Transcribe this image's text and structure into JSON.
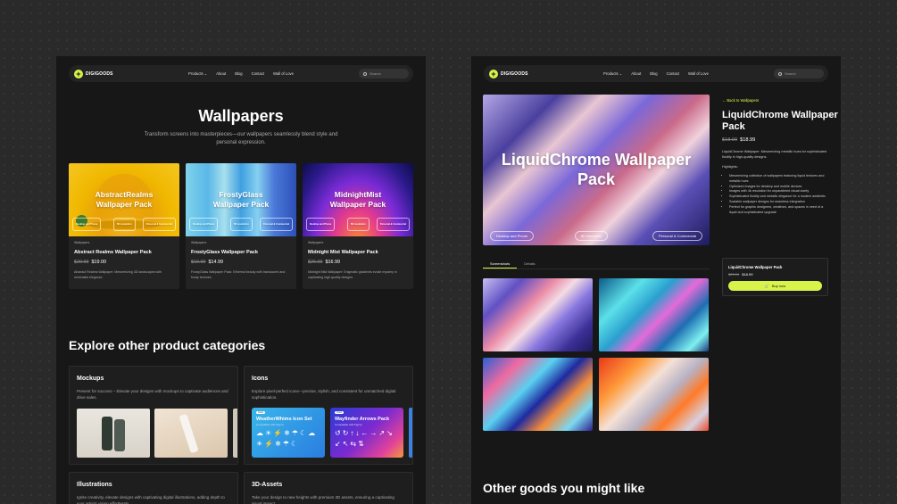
{
  "left": {
    "nav": {
      "brand": "DIGIGOODS",
      "links": [
        "Products",
        "About",
        "Blog",
        "Contact",
        "Wall of Love"
      ],
      "products_caret": "⌄",
      "search_placeholder": "Search"
    },
    "title": "Wallpapers",
    "subtitle": "Transform screens into masterpieces—our wallpapers seamlessly blend style and personal expression.",
    "cards": [
      {
        "thumb_title": "AbstractRealms Wallpaper Pack",
        "category": "Wallpapers",
        "title": "Abstract Realms Wallpaper Pack",
        "old_price": "$29.99",
        "price": "$19.00",
        "desc": "Abstract Realms Wallpaper: Mesmerizing 3D landscapes with minimalist elegance.",
        "pills": [
          "Desktop and Phone",
          "5K resolution",
          "Personal & Commercial"
        ]
      },
      {
        "thumb_title": "FrostyGlass Wallpaper Pack",
        "category": "Wallpapers",
        "title": "FrostyGlass Wallpaper Pack",
        "old_price": "$19.99",
        "price": "$14.99",
        "desc": "FrostyGlass Wallpaper Pack: Ethereal beauty with translucent and frosty textures.",
        "pills": [
          "Desktop and Phone",
          "5K resolution",
          "Personal & Commercial"
        ]
      },
      {
        "thumb_title": "MidnightMist Wallpaper Pack",
        "category": "Wallpapers",
        "title": "Midnight Mist Wallpaper Pack",
        "old_price": "$26.99",
        "price": "$16.99",
        "desc": "Midnight Mist Wallpaper: Enigmatic gradients evoke mystery in captivating high-quality designs.",
        "pills": [
          "Desktop and Phone",
          "5K resolution",
          "Personal & Commercial"
        ]
      }
    ],
    "explore_title": "Explore other product categories",
    "categories": [
      {
        "title": "Mockups",
        "desc": "Present for success – Elevate your designs with mockups to captivate audiences and drive sales."
      },
      {
        "title": "Icons",
        "desc": "Explore pixel-perfect icons—precise, stylish, and consistent for unmatched digital sophistication.",
        "packs": [
          {
            "tag": "Icons",
            "title": "WeatherWhims Icon Set",
            "sub": "Compatible with Figma",
            "glyphs": "☁☀⚡❄☂☾☁☀⚡❄☂☾"
          },
          {
            "tag": "Icons",
            "title": "Wayfinder Arrows Pack",
            "sub": "Compatible with Figma",
            "glyphs": "↺↻↑↓←→↗↘↙↖⇆⇅"
          }
        ]
      },
      {
        "title": "Illustrations",
        "desc": "Ignite creativity, elevate designs with captivating digital illustrations, adding depth to your artistic vision effortlessly."
      },
      {
        "title": "3D-Assets",
        "desc": "Take your design to new heights with premium 3D assets, ensuring a captivating visual impact."
      }
    ]
  },
  "right": {
    "nav": {
      "brand": "DIGIGOODS",
      "links": [
        "Products",
        "About",
        "Blog",
        "Contact",
        "Wall of Love"
      ],
      "products_caret": "⌄",
      "search_placeholder": "Search"
    },
    "hero": {
      "title": "LiquidChrome Wallpaper Pack",
      "pills": [
        "Desktop and Phone",
        "5K resolution",
        "Personal & Commercial"
      ]
    },
    "back": "← Back to Wallpapers",
    "title": "LiquidChrome Wallpaper Pack",
    "old_price": "$18.99",
    "price": "$18.99",
    "desc": "LiquidChrome Wallpaper: Mesmerizing metallic hues for sophisticated fluidity in high-quality designs.",
    "highlights_label": "Highlights:",
    "highlights": [
      "Mesmerizing collection of wallpapers featuring liquid textures and metallic hues",
      "Optimized images for desktop and mobile devices",
      "Images with 4k resolution for unparalleled visual clarity",
      "Sophisticated fluidity and metallic elegance for a modern aesthetic",
      "Scalable wallpaper designs for seamless integration",
      "Perfect for graphic designers, creatives, and spaces in need of a liquid and sophisticated upgrade"
    ],
    "tabs": [
      "Screenshots",
      "Details"
    ],
    "buybox": {
      "title": "LiquidChrome Wallpaper Pack",
      "old_price": "$23.99",
      "price": "$18.99",
      "button": "Buy now",
      "cart_icon": "🛒"
    },
    "other_title": "Other goods you might like"
  }
}
